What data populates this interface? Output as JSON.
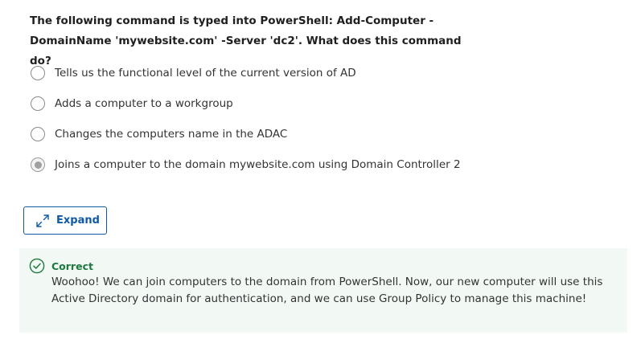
{
  "question": {
    "text": "The following command is typed into PowerShell: Add-Computer -DomainName 'mywebsite.com' -Server 'dc2'. What does this command do?"
  },
  "options": [
    {
      "label": "Tells us the functional level of the current version of AD",
      "selected": false
    },
    {
      "label": "Adds a computer to a workgroup",
      "selected": false
    },
    {
      "label": "Changes the computers name in the ADAC",
      "selected": false
    },
    {
      "label": "Joins a computer to the domain mywebsite.com using Domain Controller 2",
      "selected": true
    }
  ],
  "expand_button": {
    "label": "Expand",
    "icon": "expand-arrows-icon"
  },
  "feedback": {
    "status": "Correct",
    "icon": "check-circle-icon",
    "message": "Woohoo! We can join computers to the domain from PowerShell. Now, our new computer will use this Active Directory domain for authentication, and we can use Group Policy to manage this machine!"
  },
  "colors": {
    "accent": "#0e5aa7",
    "success": "#1c7a3e",
    "feedback_bg": "#f2f9f4"
  }
}
